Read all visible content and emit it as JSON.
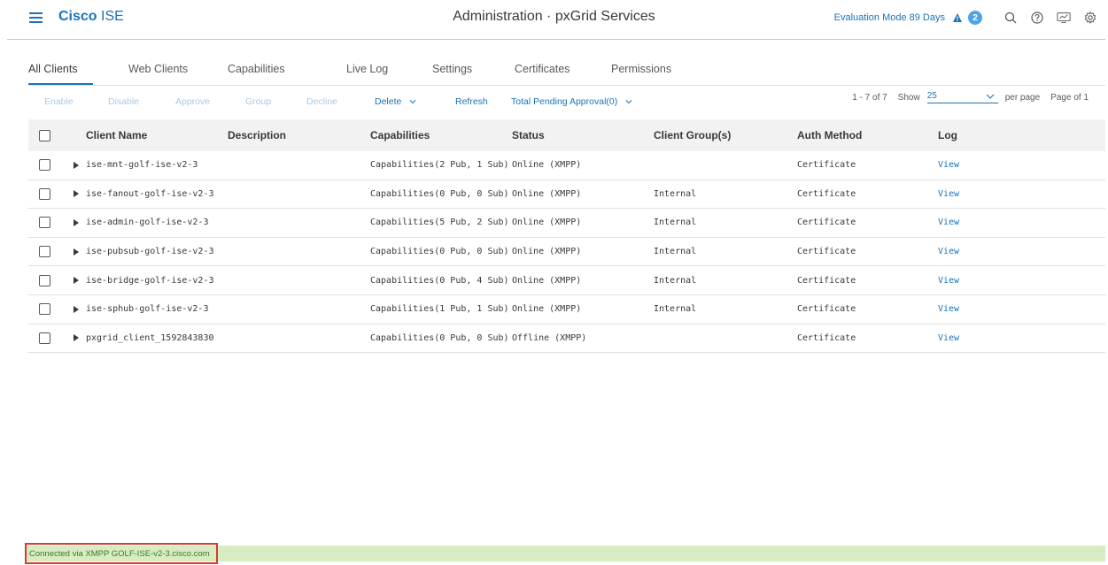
{
  "header": {
    "brand_bold": "Cisco",
    "brand_light": "ISE",
    "title": "Administration · pxGrid Services",
    "evaluation": "Evaluation Mode 89 Days",
    "alert_count": "2",
    "icons": [
      "menu-icon",
      "warning-icon",
      "search-icon",
      "help-icon",
      "monitor-icon",
      "settings-icon"
    ]
  },
  "tabs": [
    "All Clients",
    "Web Clients",
    "Capabilities",
    "Live Log",
    "Settings",
    "Certificates",
    "Permissions"
  ],
  "toolbar": {
    "enable": "Enable",
    "disable": "Disable",
    "approve": "Approve",
    "group": "Group",
    "decline": "Decline",
    "delete": "Delete",
    "refresh": "Refresh",
    "pending": "Total Pending Approval(0)"
  },
  "pager": {
    "range": "1 - 7 of 7",
    "show": "Show",
    "per_page_value": "25",
    "per_page": "per page",
    "page": "Page  of 1"
  },
  "table": {
    "headers": {
      "name": "Client Name",
      "description": "Description",
      "capabilities": "Capabilities",
      "status": "Status",
      "group": "Client Group(s)",
      "auth": "Auth Method",
      "log": "Log"
    },
    "rows": [
      {
        "name": "ise-mnt-golf-ise-v2-3",
        "description": "",
        "capabilities": "Capabilities(2 Pub, 1 Sub)",
        "status": "Online (XMPP)",
        "group": "",
        "auth": "Certificate",
        "log": "View"
      },
      {
        "name": "ise-fanout-golf-ise-v2-3",
        "description": "",
        "capabilities": "Capabilities(0 Pub, 0 Sub)",
        "status": "Online (XMPP)",
        "group": "Internal",
        "auth": "Certificate",
        "log": "View"
      },
      {
        "name": "ise-admin-golf-ise-v2-3",
        "description": "",
        "capabilities": "Capabilities(5 Pub, 2 Sub)",
        "status": "Online (XMPP)",
        "group": "Internal",
        "auth": "Certificate",
        "log": "View"
      },
      {
        "name": "ise-pubsub-golf-ise-v2-3",
        "description": "",
        "capabilities": "Capabilities(0 Pub, 0 Sub)",
        "status": "Online (XMPP)",
        "group": "Internal",
        "auth": "Certificate",
        "log": "View"
      },
      {
        "name": "ise-bridge-golf-ise-v2-3",
        "description": "",
        "capabilities": "Capabilities(0 Pub, 4 Sub)",
        "status": "Online (XMPP)",
        "group": "Internal",
        "auth": "Certificate",
        "log": "View"
      },
      {
        "name": "ise-sphub-golf-ise-v2-3",
        "description": "",
        "capabilities": "Capabilities(1 Pub, 1 Sub)",
        "status": "Online (XMPP)",
        "group": "Internal",
        "auth": "Certificate",
        "log": "View"
      },
      {
        "name": "pxgrid_client_1592843830",
        "description": "",
        "capabilities": "Capabilities(0 Pub, 0 Sub)",
        "status": "Offline (XMPP)",
        "group": "",
        "auth": "Certificate",
        "log": "View"
      }
    ]
  },
  "footer": {
    "status": "Connected via XMPP GOLF-ISE-v2-3.cisco.com"
  },
  "colors": {
    "accent": "#1a73b8",
    "footer_bg": "#d8ecc4",
    "highlight_border": "#d93a2b"
  }
}
